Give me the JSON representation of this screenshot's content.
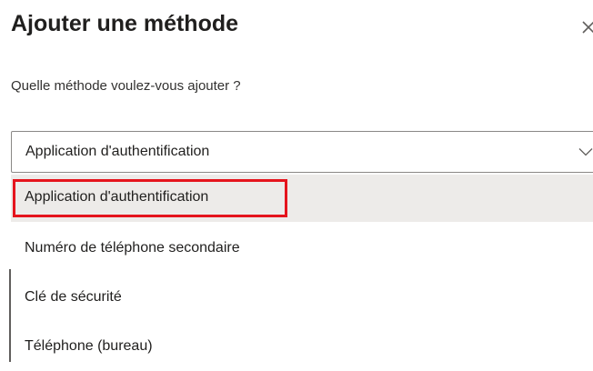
{
  "dialog": {
    "title": "Ajouter une méthode",
    "question": "Quelle méthode voulez-vous ajouter ?"
  },
  "select": {
    "value": "Application d'authentification",
    "options": [
      {
        "label": "Application d'authentification",
        "selected": true
      },
      {
        "label": "Numéro de téléphone secondaire",
        "selected": false
      },
      {
        "label": "Clé de sécurité",
        "selected": false
      },
      {
        "label": "Téléphone (bureau)",
        "selected": false
      }
    ]
  },
  "icons": {
    "close": "close-icon",
    "dropdown": "chevron-down-icon"
  },
  "colors": {
    "highlight": "#e5141d",
    "selected_bg": "#edebe9",
    "border": "#8a8886"
  }
}
